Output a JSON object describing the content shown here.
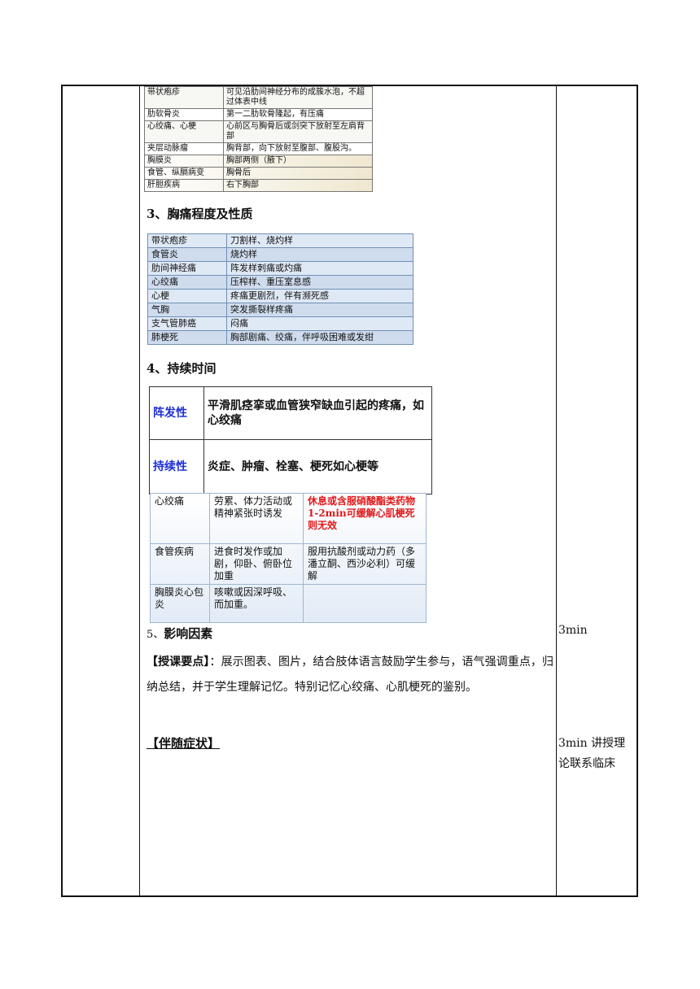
{
  "table1": {
    "rows": [
      [
        "带状疱疹",
        "可见沿肋间神经分布的成簇水泡，不超过体表中线"
      ],
      [
        "肋软骨炎",
        "第一二肋软骨隆起，有压痛"
      ],
      [
        "心绞痛、心梗",
        "心前区与胸骨后或剑突下放射至左肩背部"
      ],
      [
        "夹层动脉瘤",
        "胸背部，向下放射至腹部、腹股沟。"
      ],
      [
        "胸膜炎",
        "胸部两侧（腋下）"
      ],
      [
        "食管、纵膈病变",
        "胸骨后"
      ],
      [
        "肝胆疾病",
        "右下胸部"
      ]
    ]
  },
  "heading3": {
    "num": "3、",
    "text": "胸痛程度及性质"
  },
  "table2": {
    "rows": [
      [
        "带状疱疹",
        "刀割样、烧灼样"
      ],
      [
        "食管炎",
        "烧灼样"
      ],
      [
        "肋间神经痛",
        "阵发样刺痛或灼痛"
      ],
      [
        "心绞痛",
        "压榨样、重压室息感"
      ],
      [
        "心梗",
        "疼痛更剧烈，伴有濒死感"
      ],
      [
        "气胸",
        "突发撕裂样疼痛"
      ],
      [
        "支气管肺癌",
        "闷痛"
      ],
      [
        "肺梗死",
        "胸部剧痛、绞痛，伴呼吸困难或发绀"
      ]
    ]
  },
  "heading4": {
    "num": "4、",
    "text": "持续时间"
  },
  "table3": {
    "rows": [
      [
        "阵发性",
        "平滑肌痉挛或血管狭窄缺血引起的疼痛，如心绞痛"
      ],
      [
        "持续性",
        "炎症、肿瘤、栓塞、梗死如心梗等"
      ]
    ]
  },
  "table4": {
    "rows": [
      {
        "c1": "心绞痛",
        "c2": "劳累、体力活动或精神紧张时诱发",
        "c3": "休息或含服硝酸酯类药物1-2min可缓解心肌梗死则无效"
      },
      {
        "c1": "食管疾病",
        "c2": "进食时发作或加剧，仰卧、俯卧位加重",
        "c3": "服用抗酸剂或动力药（多潘立酮、西沙必利）可缓解"
      },
      {
        "c1": "胸膜炎心包炎",
        "c2": "咳嗽或因深呼吸、而加重。",
        "c3": ""
      }
    ]
  },
  "section5": {
    "num": "5、",
    "text": "影响因素"
  },
  "teaching": {
    "label": "【授课要点】",
    "text": "：展示图表、图片，结合肢体语言鼓励学生参与，语气强调重点，归纳总结，并于学生理解记忆。特别记忆心绞痛、心肌梗死的鉴别。"
  },
  "accompany": "【伴随症状】",
  "side": {
    "time1": "3min",
    "time2": "3min 讲授理论联系临床"
  }
}
